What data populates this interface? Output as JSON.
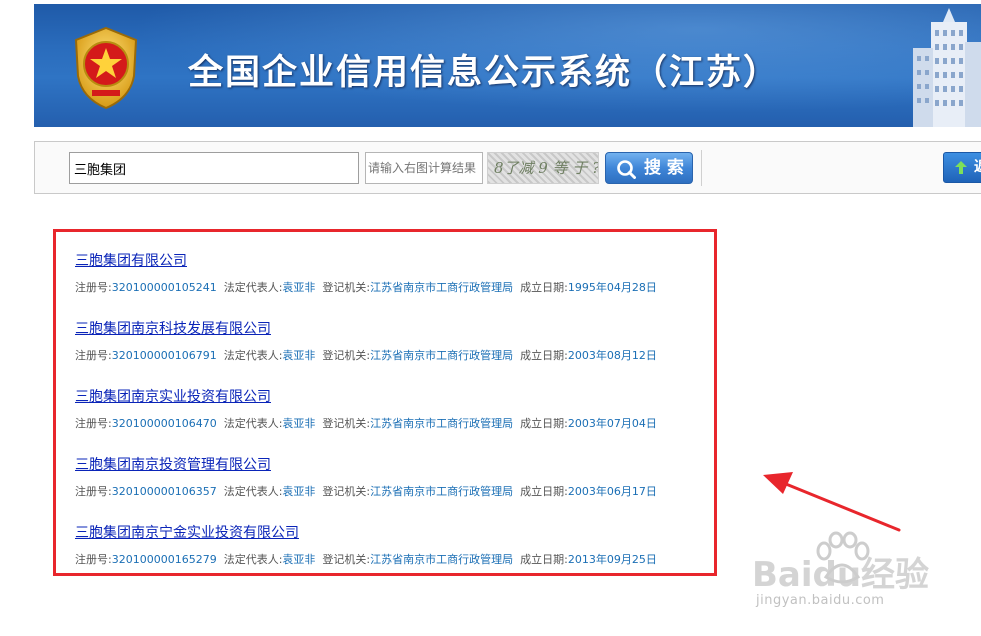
{
  "header": {
    "title": "全国企业信用信息公示系统（江苏）"
  },
  "search": {
    "keyword_value": "三胞集团",
    "calc_placeholder": "请输入右图计算结果",
    "captcha_text": "8了减 9 等 于 ?",
    "button_label": "搜 索",
    "right_button_label": "返"
  },
  "labels": {
    "reg_no": "注册号:",
    "legal_rep": "法定代表人:",
    "authority": "登记机关:",
    "founded": "成立日期:"
  },
  "results": [
    {
      "name": "三胞集团有限公司",
      "reg_no": "320100000105241",
      "legal_rep": "袁亚非",
      "authority": "江苏省南京市工商行政管理局",
      "founded": "1995年04月28日"
    },
    {
      "name": "三胞集团南京科技发展有限公司",
      "reg_no": "320100000106791",
      "legal_rep": "袁亚非",
      "authority": "江苏省南京市工商行政管理局",
      "founded": "2003年08月12日"
    },
    {
      "name": "三胞集团南京实业投资有限公司",
      "reg_no": "320100000106470",
      "legal_rep": "袁亚非",
      "authority": "江苏省南京市工商行政管理局",
      "founded": "2003年07月04日"
    },
    {
      "name": "三胞集团南京投资管理有限公司",
      "reg_no": "320100000106357",
      "legal_rep": "袁亚非",
      "authority": "江苏省南京市工商行政管理局",
      "founded": "2003年06月17日"
    },
    {
      "name": "三胞集团南京宁金实业投资有限公司",
      "reg_no": "320100000165279",
      "legal_rep": "袁亚非",
      "authority": "江苏省南京市工商行政管理局",
      "founded": "2013年09月25日"
    }
  ],
  "watermark": {
    "brand": "Baidu经验",
    "url": "jingyan.baidu.com"
  },
  "colors": {
    "banner_blue": "#2a6cbc",
    "highlight_red": "#e8262c",
    "link_blue": "#0a24b8",
    "value_blue": "#1b6fb5"
  }
}
